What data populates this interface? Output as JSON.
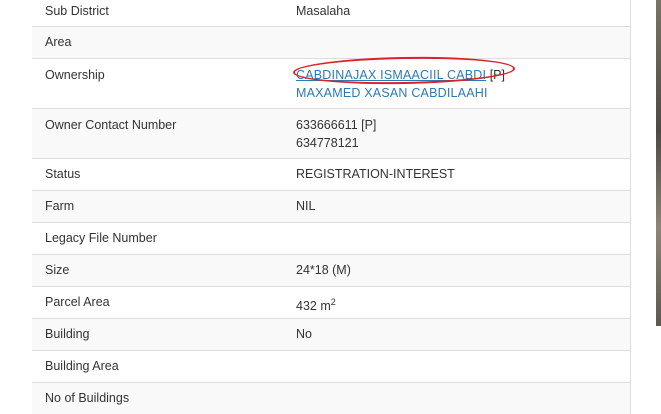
{
  "rows": {
    "sub_district": {
      "label": "Sub District",
      "value": "Masalaha"
    },
    "area": {
      "label": "Area",
      "value": ""
    },
    "ownership": {
      "label": "Ownership",
      "owners": [
        {
          "name": "CABDINAJAX ISMAACIIL CABDI",
          "tag": "[P]"
        },
        {
          "name": "MAXAMED XASAN CABDILAAHI",
          "tag": ""
        }
      ]
    },
    "owner_contact": {
      "label": "Owner Contact Number",
      "numbers": [
        {
          "number": "633666611",
          "tag": "[P]"
        },
        {
          "number": "634778121",
          "tag": ""
        }
      ]
    },
    "status": {
      "label": "Status",
      "value": "REGISTRATION-INTEREST"
    },
    "farm": {
      "label": "Farm",
      "value": "NIL"
    },
    "legacy_file_number": {
      "label": "Legacy File Number",
      "value": ""
    },
    "size": {
      "label": "Size",
      "value": "24*18 (M)"
    },
    "parcel_area": {
      "label": "Parcel Area",
      "value": "432 m",
      "unit_sup": "2"
    },
    "building": {
      "label": "Building",
      "value": "No"
    },
    "building_area": {
      "label": "Building Area",
      "value": ""
    },
    "no_of_buildings": {
      "label": "No of Buildings",
      "value": ""
    }
  },
  "colors": {
    "link": "#2a7ab8",
    "annotation": "#d8232a",
    "border": "#dddddd",
    "stripe": "#f9f9f9"
  }
}
